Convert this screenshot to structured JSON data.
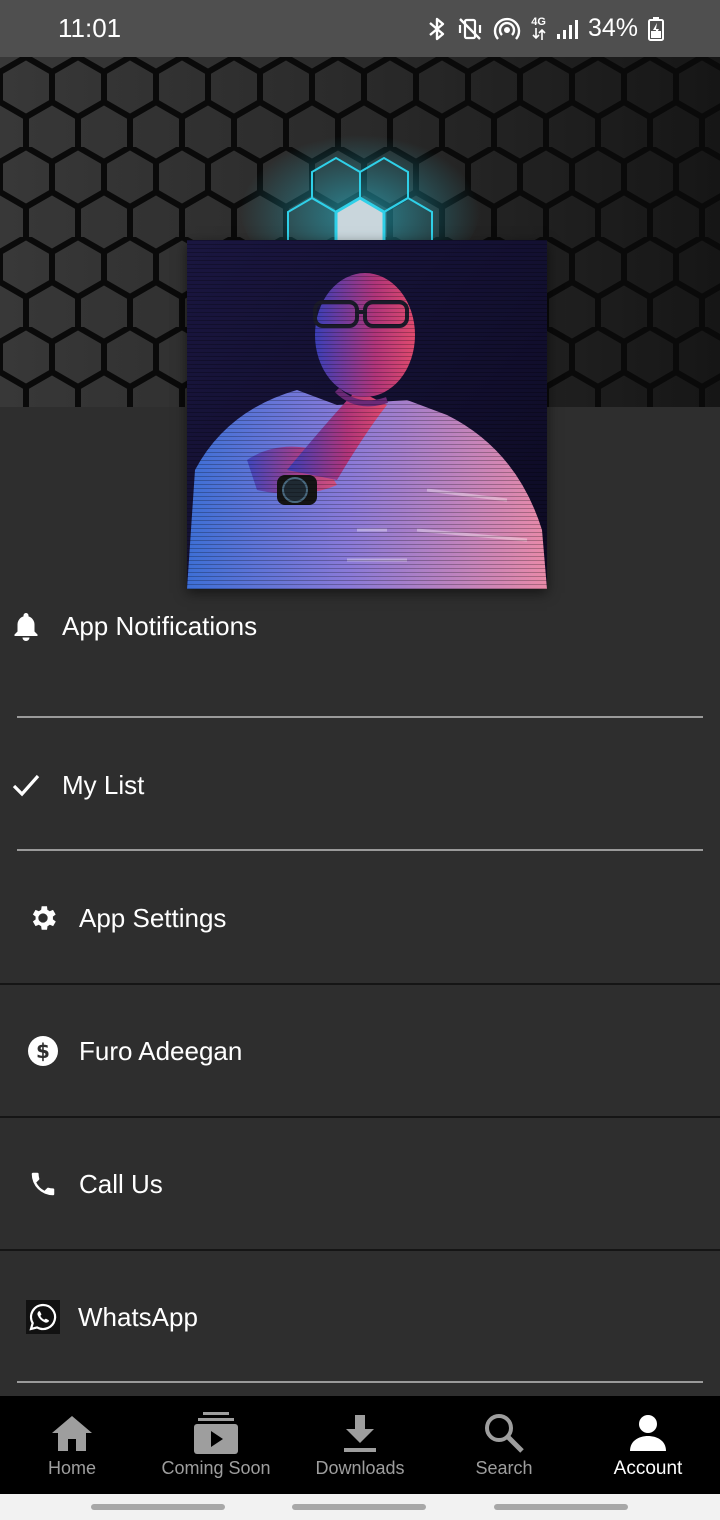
{
  "status_bar": {
    "time": "11:01",
    "network": "4G",
    "battery": "34%",
    "icons": [
      "bluetooth-icon",
      "vibrate-mute-icon",
      "hotspot-icon",
      "network-4g-icon",
      "signal-icon",
      "battery-charging-icon"
    ]
  },
  "profile": {
    "cover_image": "hexagon-pattern",
    "avatar_image": "profile-photo"
  },
  "menu": {
    "items": [
      {
        "label": "App Notifications",
        "icon": "bell-icon"
      },
      {
        "label": "My List",
        "icon": "check-icon"
      },
      {
        "label": "App Settings",
        "icon": "gear-icon"
      },
      {
        "label": "Furo Adeegan",
        "icon": "dollar-circle-icon"
      },
      {
        "label": "Call Us",
        "icon": "phone-icon"
      },
      {
        "label": "WhatsApp",
        "icon": "whatsapp-icon"
      }
    ]
  },
  "bottom_nav": {
    "items": [
      {
        "label": "Home",
        "icon": "home-icon"
      },
      {
        "label": "Coming Soon",
        "icon": "coming-soon-icon"
      },
      {
        "label": "Downloads",
        "icon": "download-icon"
      },
      {
        "label": "Search",
        "icon": "search-icon"
      },
      {
        "label": "Account",
        "icon": "account-icon"
      }
    ],
    "active": "Account"
  },
  "colors": {
    "background": "#2e2e2e",
    "status_bar": "#4f4f4f",
    "nav_background": "#000000",
    "nav_inactive": "#9e9e9e",
    "nav_active": "#ffffff",
    "divider_light": "#9a9a9a",
    "divider_dark": "#151515",
    "hex_glow": "#2fd0e8"
  }
}
